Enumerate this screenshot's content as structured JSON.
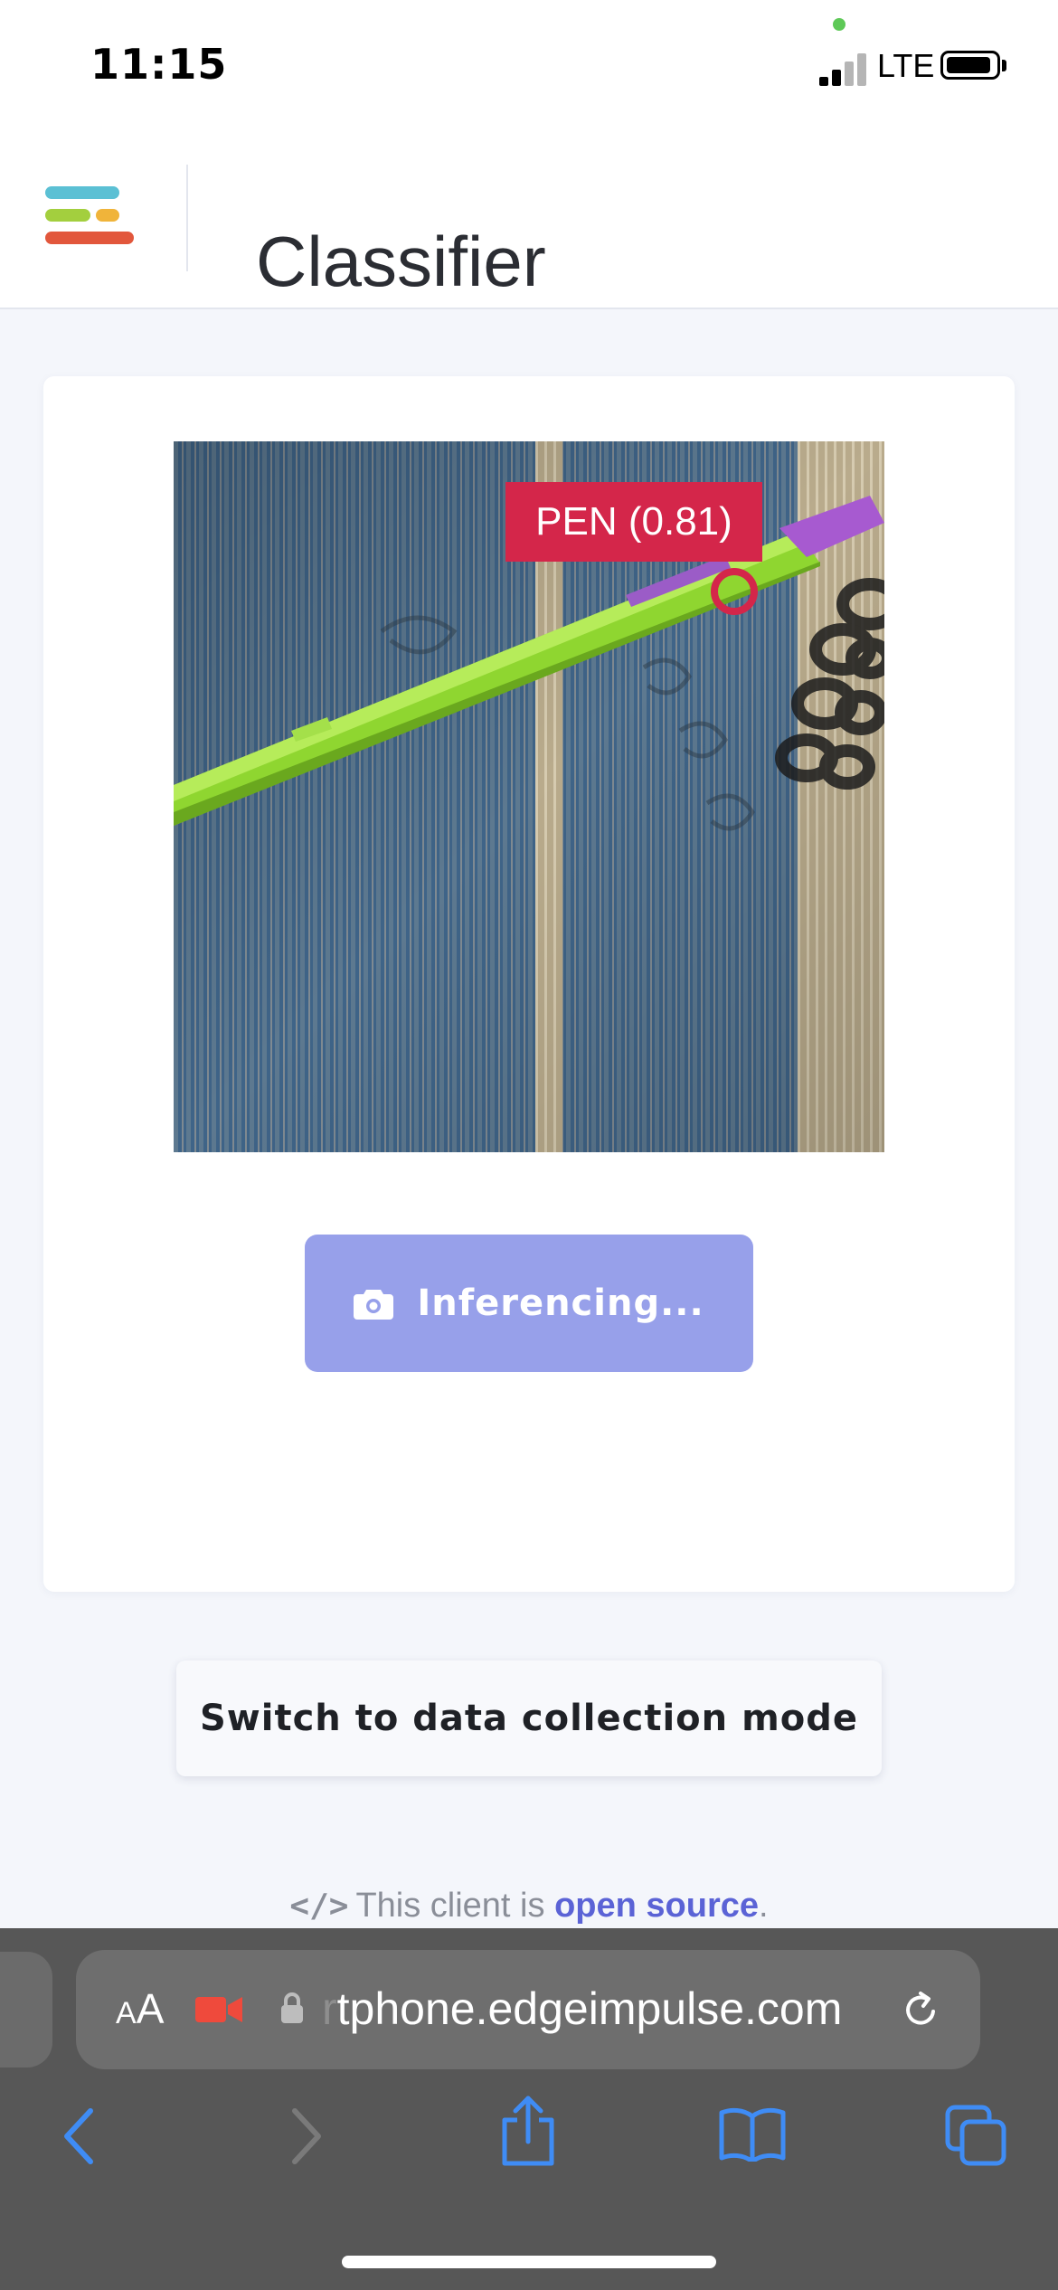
{
  "status_bar": {
    "time": "11:15",
    "network": "LTE",
    "indicator_color": "#5ec957"
  },
  "header": {
    "title": "Classifier",
    "logo_colors": [
      "#5bc0d4",
      "#a3cf3e",
      "#f0b43a",
      "#e2573c"
    ]
  },
  "classifier": {
    "detection_label": "PEN (0.81)",
    "detection_color": "#d4264a",
    "inference_button_label": "Inferencing...",
    "inference_button_color": "#97a0ea",
    "camera_icon": "camera-icon"
  },
  "mode_switch": {
    "label": "Switch to data collection mode"
  },
  "footer": {
    "code_icon": "</>",
    "text_prefix": "This client is ",
    "link_text": "open source",
    "text_suffix": "."
  },
  "browser": {
    "text_size_label_small": "A",
    "text_size_label_large": "A",
    "url_hidden_prefix": "r",
    "url_visible": "tphone.edgeimpulse.com",
    "accent_color": "#3f8cf5",
    "recording_color": "#ef4a3c",
    "toolbar_icons": [
      "back-icon",
      "forward-icon",
      "share-icon",
      "bookmarks-icon",
      "tabs-icon"
    ]
  }
}
